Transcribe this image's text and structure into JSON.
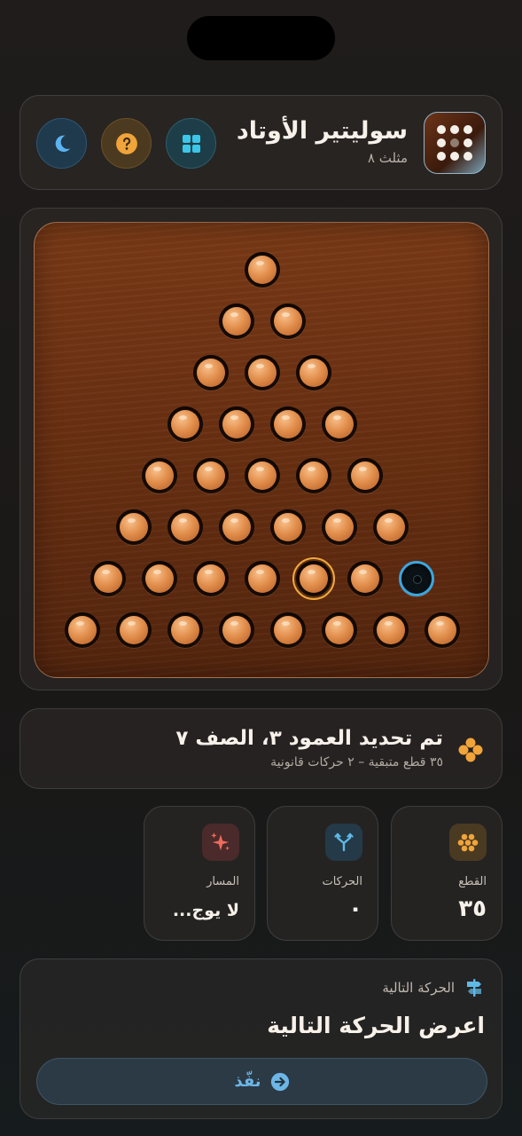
{
  "header": {
    "title": "سوليتير الأوتاد",
    "subtitle": "مثلث ٨",
    "buttons": {
      "theme_icon": "moon-icon",
      "help_icon": "question-icon",
      "menu_icon": "grid-icon"
    },
    "logo_icon": "peg-grid-icon"
  },
  "board": {
    "shape": "triangle",
    "rows": 8,
    "cells": [
      [
        "peg"
      ],
      [
        "peg",
        "peg"
      ],
      [
        "peg",
        "peg",
        "peg"
      ],
      [
        "peg",
        "peg",
        "peg",
        "peg"
      ],
      [
        "peg",
        "peg",
        "peg",
        "peg",
        "peg"
      ],
      [
        "peg",
        "peg",
        "peg",
        "peg",
        "peg",
        "peg"
      ],
      [
        "peg",
        "peg",
        "peg",
        "peg",
        "selected",
        "peg",
        "target"
      ],
      [
        "peg",
        "peg",
        "peg",
        "peg",
        "peg",
        "peg",
        "peg",
        "peg"
      ]
    ],
    "colors": {
      "selected_ring": "#f2a93b",
      "target_ring": "#3aa6e0"
    }
  },
  "status": {
    "title": "تم تحديد العمود ٣، الصف ٧",
    "subtitle": "٣٥ قطع متبقية – ٢ حركات قانونية",
    "icon": "pegs-cluster-icon"
  },
  "stats": [
    {
      "key": "pieces",
      "label": "القطع",
      "value": "٣٥",
      "icon": "honeycomb-icon",
      "color": "#f0a43a"
    },
    {
      "key": "moves",
      "label": "الحركات",
      "value": "٠",
      "icon": "branch-icon",
      "color": "#5fb9e6"
    },
    {
      "key": "path",
      "label": "المسار",
      "value": "لا يوج...",
      "icon": "sparkle-icon",
      "color": "#ef6b5b"
    }
  ],
  "next_move": {
    "label": "الحركة التالية",
    "title": "اعرض الحركة التالية",
    "button_label": "نفّذ",
    "label_icon": "signpost-icon",
    "button_icon": "arrow-circle-icon"
  }
}
